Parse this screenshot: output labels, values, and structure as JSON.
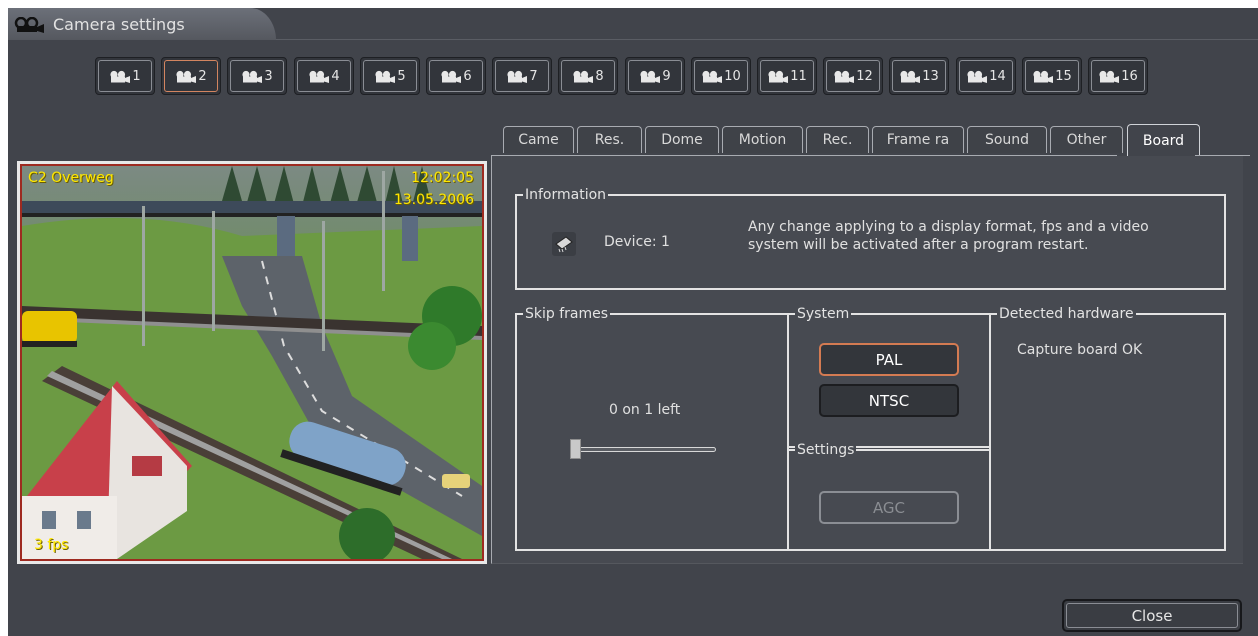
{
  "window": {
    "title": "Camera settings",
    "title_icon": "camera-icon"
  },
  "cameras": [
    {
      "num": "1"
    },
    {
      "num": "2",
      "selected": true
    },
    {
      "num": "3"
    },
    {
      "num": "4"
    },
    {
      "num": "5"
    },
    {
      "num": "6"
    },
    {
      "num": "7"
    },
    {
      "num": "8"
    },
    {
      "num": "9"
    },
    {
      "num": "10"
    },
    {
      "num": "11"
    },
    {
      "num": "12"
    },
    {
      "num": "13"
    },
    {
      "num": "14"
    },
    {
      "num": "15"
    },
    {
      "num": "16"
    }
  ],
  "tabs": [
    {
      "label": "Came"
    },
    {
      "label": "Res."
    },
    {
      "label": "Dome"
    },
    {
      "label": "Motion"
    },
    {
      "label": "Rec."
    },
    {
      "label": "Frame ra"
    },
    {
      "label": "Sound"
    },
    {
      "label": "Other"
    },
    {
      "label": "Board",
      "active": true
    }
  ],
  "video": {
    "camera_name": "C2 Overweg",
    "time": "12:02:05",
    "date": "13.05.2006",
    "fps": "3 fps"
  },
  "information": {
    "title": "Information",
    "device_icon": "chip-icon",
    "device": "Device: 1",
    "notice_line1": "Any change applying to a display format, fps and a video",
    "notice_line2": "system will be activated after a program restart."
  },
  "skip_frames": {
    "title": "Skip frames",
    "value_text": "0 on 1 left",
    "slider_value": 0
  },
  "system": {
    "title": "System",
    "options": [
      "PAL",
      "NTSC"
    ],
    "selected": "PAL"
  },
  "settings": {
    "title": "Settings",
    "agc_label": "AGC",
    "agc_enabled": false
  },
  "detected_hardware": {
    "title": "Detected hardware",
    "status": "Capture board OK"
  },
  "footer": {
    "close_label": "Close"
  },
  "colors": {
    "background": "#41444b",
    "panel": "#474a51",
    "selected_border": "#d47b52",
    "osd_text": "#ffe800"
  }
}
